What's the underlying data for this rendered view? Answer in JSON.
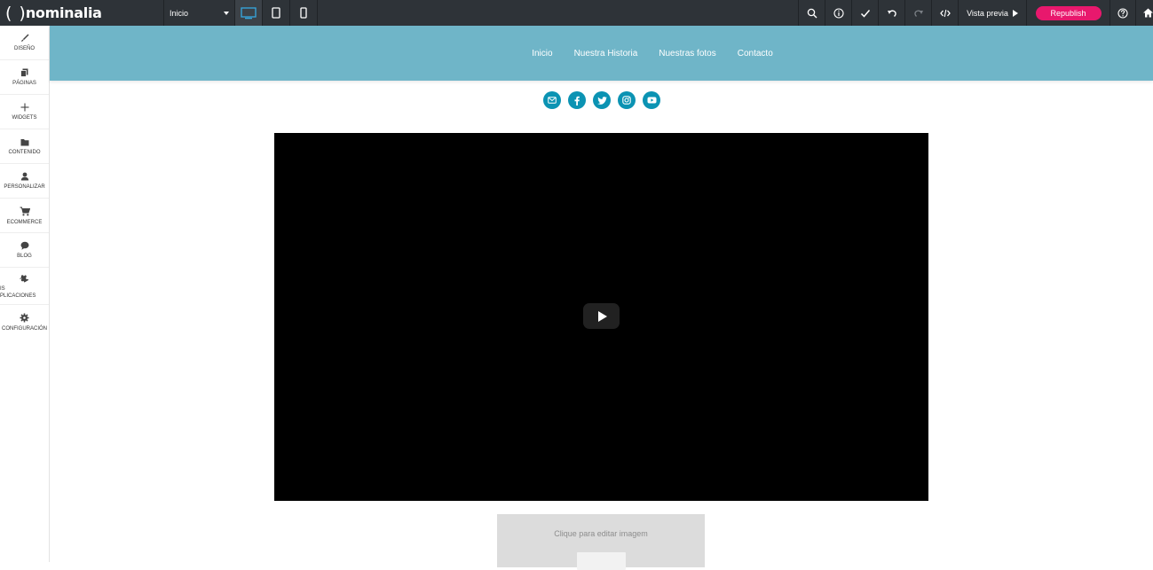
{
  "toolbar": {
    "logo_paren": "( )",
    "logo_brand": "nominalia",
    "page_select_value": "Inicio",
    "preview_label": "Vista previa",
    "republish_label": "Republish",
    "accent_color": "#e8186d"
  },
  "sidebar": {
    "items": [
      {
        "label": "DISEÑO",
        "icon": "brush-icon"
      },
      {
        "label": "PÁGINAS",
        "icon": "pages-icon"
      },
      {
        "label": "WIDGETS",
        "icon": "plus-icon"
      },
      {
        "label": "CONTENIDO",
        "icon": "folder-icon"
      },
      {
        "label": "PERSONALIZAR",
        "icon": "user-icon"
      },
      {
        "label": "ECOMMERCE",
        "icon": "cart-icon"
      },
      {
        "label": "BLOG",
        "icon": "chat-icon"
      },
      {
        "label_line1": "IS",
        "label_line2": "PLICACIONES",
        "icon": "puzzle-icon"
      },
      {
        "label": "CONFIGURACIÓN",
        "icon": "gear-icon"
      }
    ]
  },
  "site": {
    "header_color": "#6fb5c8",
    "nav": [
      "Inicio",
      "Nuestra Historia",
      "Nuestras fotos",
      "Contacto"
    ],
    "social_color": "#0b93b3",
    "socials": [
      "email-icon",
      "facebook-icon",
      "twitter-icon",
      "instagram-icon",
      "youtube-icon"
    ],
    "image_placeholder_text": "Clique para editar imagem"
  }
}
